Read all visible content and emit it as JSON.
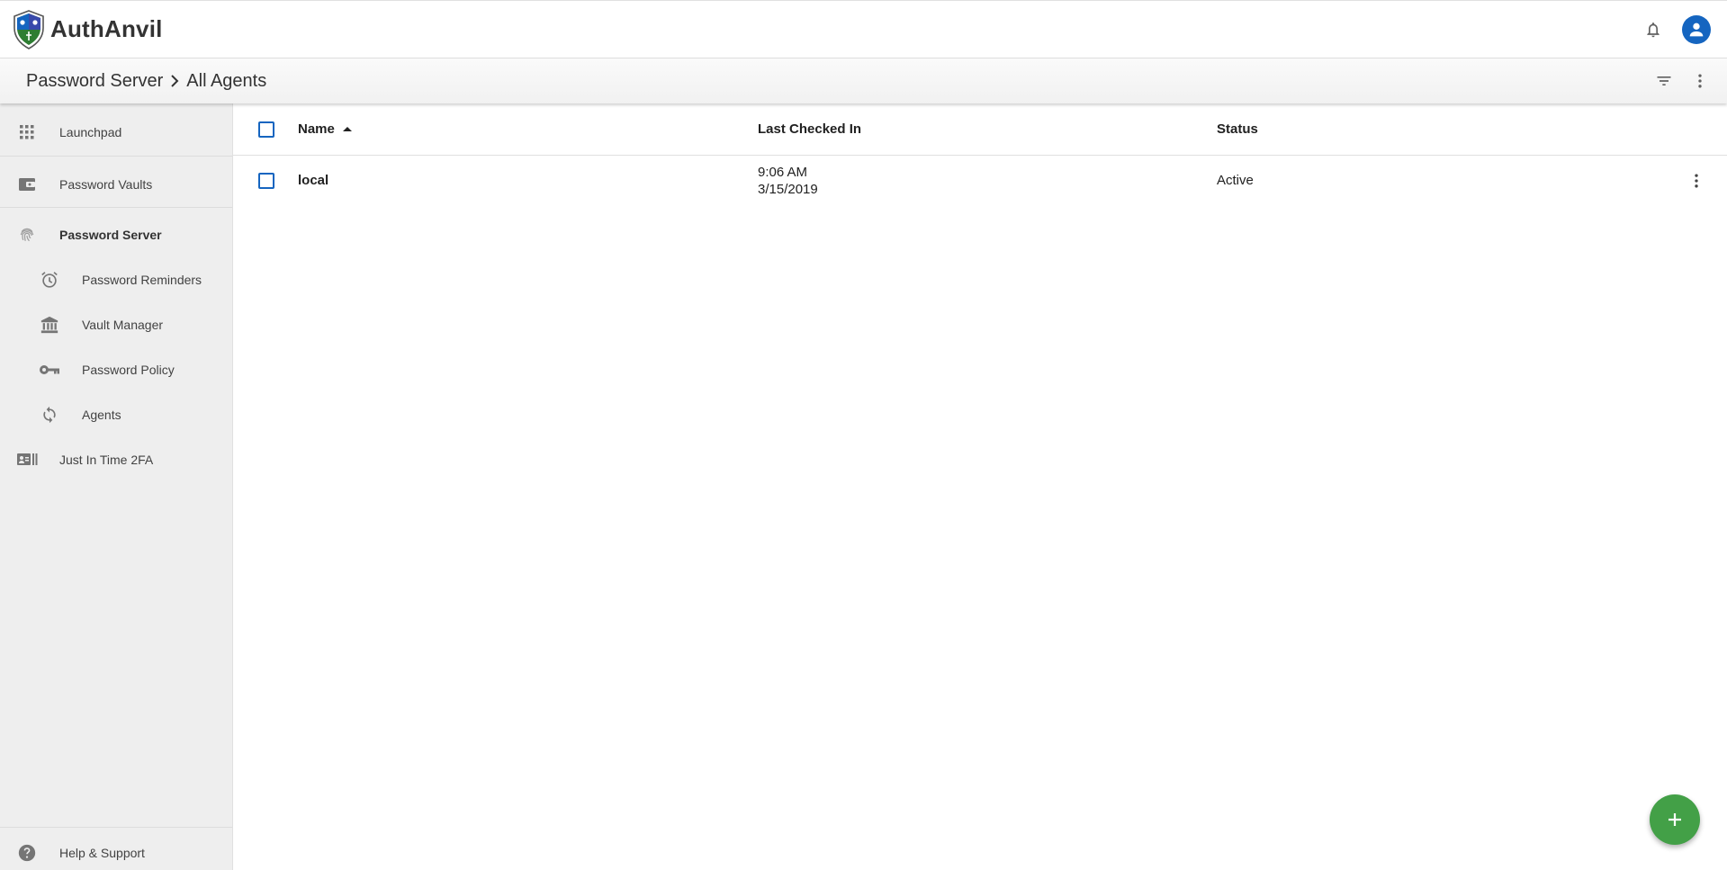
{
  "app": {
    "brand_name": "AuthAnvil",
    "icons": {
      "logo": "shield-logo",
      "notifications": "bell-icon",
      "account": "account-circle-icon"
    }
  },
  "breadcrumb": {
    "parent": "Password Server",
    "separator_icon": "chevron-right-icon",
    "current": "All Agents"
  },
  "toolbar": {
    "filter_icon": "filter-list-icon",
    "more_icon": "more-vert-icon"
  },
  "sidebar": {
    "items": [
      {
        "label": "Launchpad",
        "icon": "apps-grid-icon"
      },
      {
        "label": "Password Vaults",
        "icon": "wallet-icon"
      },
      {
        "label": "Password Server",
        "icon": "fingerprint-icon",
        "active": true
      },
      {
        "label": "Password Reminders",
        "icon": "alarm-icon",
        "sub": true
      },
      {
        "label": "Vault Manager",
        "icon": "bank-icon",
        "sub": true
      },
      {
        "label": "Password Policy",
        "icon": "key-icon",
        "sub": true
      },
      {
        "label": "Agents",
        "icon": "sync-icon",
        "sub": true
      },
      {
        "label": "Just In Time 2FA",
        "icon": "id-card-icon"
      }
    ],
    "footer": {
      "label": "Help & Support",
      "icon": "help-circle-icon"
    }
  },
  "table": {
    "columns": [
      {
        "label": "Name",
        "sort": "ascending"
      },
      {
        "label": "Last Checked In"
      },
      {
        "label": "Status"
      }
    ],
    "rows": [
      {
        "name": "local",
        "time": "9:06 AM",
        "date": "3/15/2019",
        "status": "Active"
      }
    ]
  },
  "fab": {
    "icon": "add-icon"
  },
  "colors": {
    "accent_blue": "#1565c0",
    "fab_green": "#43a047",
    "sidebar_bg": "#eeeeee"
  }
}
